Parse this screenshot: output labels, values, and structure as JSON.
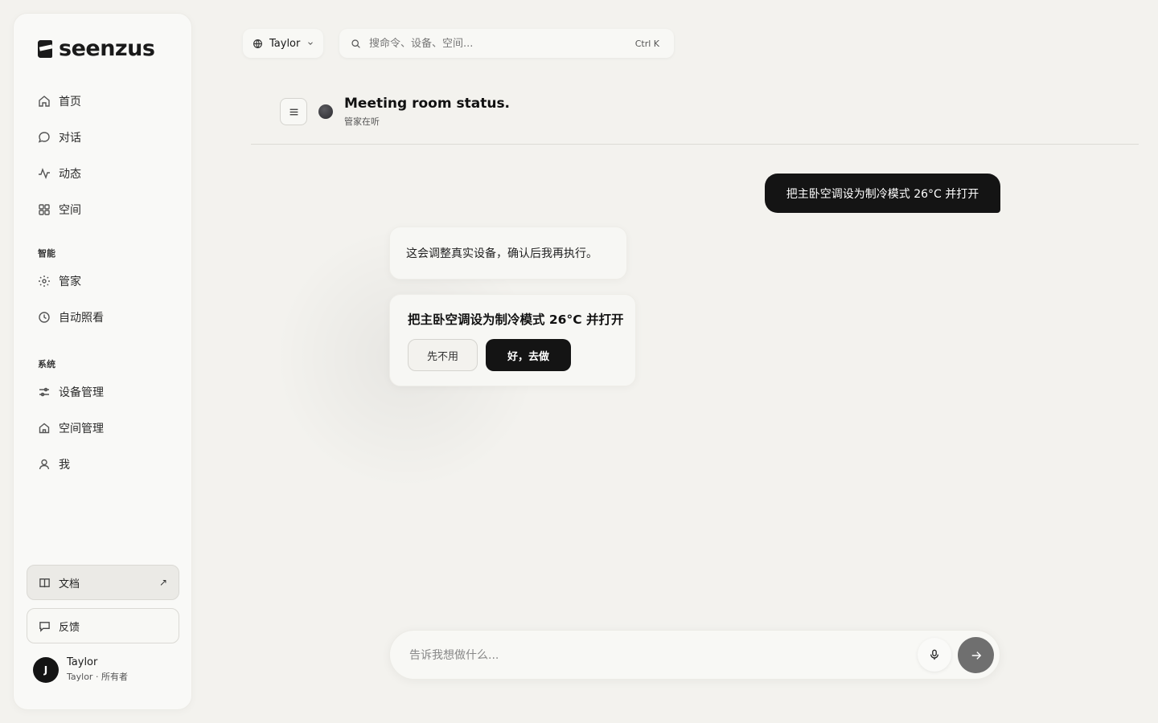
{
  "brand": {
    "name": "seenzus",
    "logo_icon": "seenzus-logo-icon"
  },
  "sidebar": {
    "nav": [
      {
        "label": "首页",
        "icon": "home-icon",
        "active": false
      },
      {
        "label": "对话",
        "icon": "chat-icon",
        "active": true
      },
      {
        "label": "动态",
        "icon": "activity-icon",
        "active": false
      },
      {
        "label": "空间",
        "icon": "grid-icon",
        "active": false
      }
    ],
    "section_smart": "智能",
    "smart_items": [
      {
        "label": "管家",
        "icon": "butler-sparkle-icon"
      },
      {
        "label": "自动照看",
        "icon": "clock-icon"
      }
    ],
    "section_system": "系统",
    "system_items": [
      {
        "label": "设备管理",
        "icon": "sliders-icon"
      },
      {
        "label": "空间管理",
        "icon": "house-icon"
      },
      {
        "label": "我",
        "icon": "user-icon"
      }
    ],
    "docs_label": "文档",
    "docs_external_glyph": "↗",
    "feedback_label": "反馈",
    "user": {
      "initial": "J",
      "name": "Taylor",
      "sub": "Taylor · 所有者"
    }
  },
  "topbar": {
    "workspace": "Taylor",
    "search_placeholder": "搜命令、设备、空间...",
    "shortcut": "Ctrl K"
  },
  "chat": {
    "title": "Meeting room status.",
    "subtitle": "管家在听",
    "messages": {
      "user_1": "把主卧空调设为制冷模式 26°C 并打开",
      "bot_1": "这会调整真实设备，确认后我再执行。"
    },
    "confirm": {
      "title": "把主卧空调设为制冷模式 26°C 并打开",
      "cancel_label": "先不用",
      "ok_label": "好，去做"
    },
    "composer_placeholder": "告诉我想做什么..."
  },
  "colors": {
    "background": "#f3f2ee",
    "primary_dark": "#141414",
    "send_button": "#6f6f6f"
  }
}
